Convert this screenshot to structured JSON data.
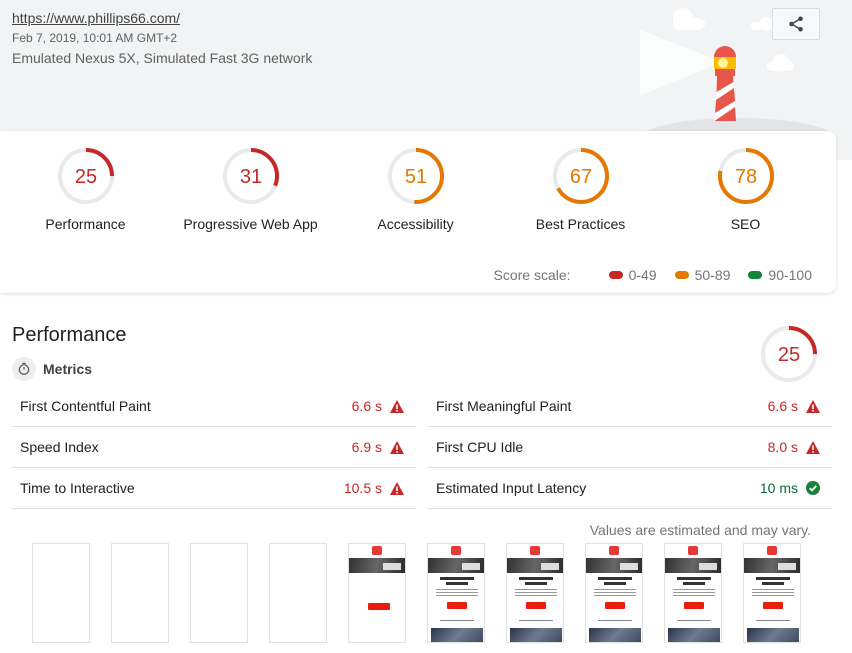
{
  "header": {
    "url": "https://www.phillips66.com/",
    "timestamp": "Feb 7, 2019, 10:01 AM GMT+2",
    "environment": "Emulated Nexus 5X, Simulated Fast 3G network",
    "share_icon": "share-icon"
  },
  "categories": [
    {
      "label": "Performance",
      "score": 25,
      "rating": "fail"
    },
    {
      "label": "Progressive Web App",
      "score": 31,
      "rating": "fail"
    },
    {
      "label": "Accessibility",
      "score": 51,
      "rating": "average"
    },
    {
      "label": "Best Practices",
      "score": 67,
      "rating": "average"
    },
    {
      "label": "SEO",
      "score": 78,
      "rating": "average"
    }
  ],
  "score_scale": {
    "title": "Score scale:",
    "items": [
      {
        "label": "0-49",
        "color": "#c62828"
      },
      {
        "label": "50-89",
        "color": "#e67700"
      },
      {
        "label": "90-100",
        "color": "#178239"
      }
    ]
  },
  "colors": {
    "fail": "#c62828",
    "average": "#e67700",
    "pass": "#178239",
    "track": "#e8eaed"
  },
  "performance": {
    "title": "Performance",
    "score": 25,
    "metrics_label": "Metrics",
    "metrics_left": [
      {
        "name": "First Contentful Paint",
        "value": "6.6 s",
        "status": "fail"
      },
      {
        "name": "Speed Index",
        "value": "6.9 s",
        "status": "fail"
      },
      {
        "name": "Time to Interactive",
        "value": "10.5 s",
        "status": "fail"
      }
    ],
    "metrics_right": [
      {
        "name": "First Meaningful Paint",
        "value": "6.6 s",
        "status": "fail"
      },
      {
        "name": "First CPU Idle",
        "value": "8.0 s",
        "status": "fail"
      },
      {
        "name": "Estimated Input Latency",
        "value": "10 ms",
        "status": "pass"
      }
    ],
    "note": "Values are estimated and may vary.",
    "filmstrip": [
      "blank",
      "blank",
      "blank",
      "blank",
      "partial",
      "loaded",
      "loaded",
      "loaded",
      "loaded",
      "loaded"
    ]
  }
}
